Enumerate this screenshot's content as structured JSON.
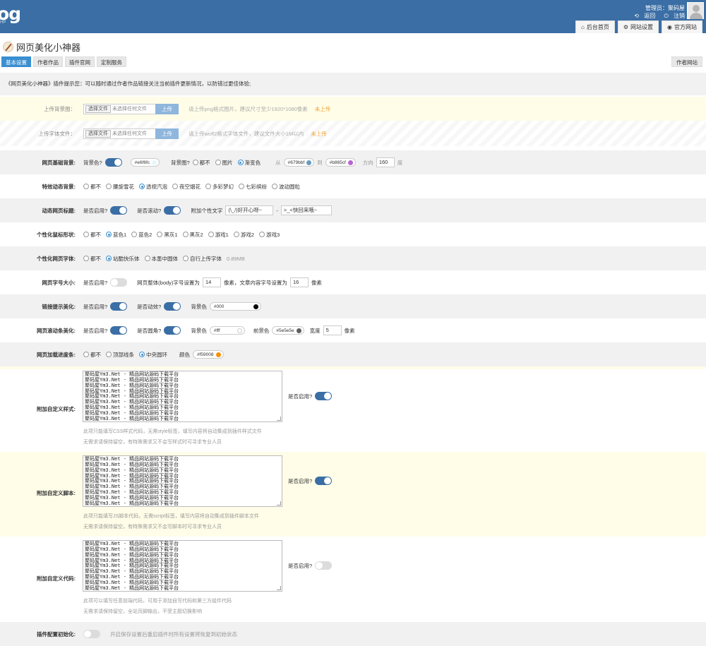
{
  "header": {
    "logo": "og",
    "logo_sub": "HP",
    "admin_label": "管理员：聚码屋",
    "back_link": "返回",
    "logout_link": "注销",
    "nav": [
      {
        "label": "后台首页",
        "icon": "home-icon"
      },
      {
        "label": "网站设置",
        "icon": "gear-icon"
      },
      {
        "label": "官方网站",
        "icon": "compass-icon"
      }
    ]
  },
  "page": {
    "title": "网页美化小神器"
  },
  "tabs": [
    "基本设置",
    "作者作品",
    "插件官网",
    "定制服务"
  ],
  "author_site_btn": "作者网站",
  "notice": "《网页美化小神器》插件提示您：可以随时通过作者作品链接关注当前插件更新情况，以防错过更佳体验;",
  "upload_bg": {
    "label": "上传背景图：",
    "choose": "选择文件",
    "no_file": "未选择任何文件",
    "upload": "上传",
    "hint": "请上传png格式图片，建议尺寸至少1920*1080像素",
    "status": "未上传"
  },
  "upload_font": {
    "label": "上传字体文件：",
    "choose": "选择文件",
    "no_file": "未选择任何文件",
    "upload": "上传",
    "hint": "请上传woff2格式字体文件，建议文件大小1M以内",
    "status": "未上传"
  },
  "bg": {
    "label": "网页基础背景:",
    "color_label": "背景色?",
    "color_value": "#e6f6fc",
    "color_hex": "#e6f6fc",
    "image_label": "背景图?",
    "options": [
      "都不",
      "图片",
      "渐变色"
    ],
    "selected": 2,
    "from_label": "从",
    "from_value": "#679bbf",
    "from_hex": "#679bbf",
    "to_label": "到",
    "to_value": "#b865cf",
    "to_hex": "#b865cf",
    "dir_label": "方向",
    "dir_value": "160",
    "dir_unit": "度"
  },
  "effect": {
    "label": "特效动态背景:",
    "options": [
      "都不",
      "腰旋雪花",
      "透视汽泡",
      "夜空烟花",
      "多彩梦幻",
      "七彩缤纷",
      "波动圆粒"
    ],
    "selected": 2
  },
  "dyntitle": {
    "label": "动态网页标题:",
    "enable_label": "是否启用?",
    "enabled": true,
    "scroll_label": "是否滚动?",
    "scroll": true,
    "text_label": "附加个性文字",
    "text1": "(\\_/)好开心呀~",
    "sep": "-",
    "text2": ">_<快回来哦~"
  },
  "cursor": {
    "label": "个性化鼠标形状:",
    "options": [
      "都不",
      "蓝色1",
      "蓝色2",
      "黑灰1",
      "黑灰2",
      "游戏1",
      "游戏2",
      "游戏3"
    ],
    "selected": 1
  },
  "font": {
    "label": "个性化网页字体:",
    "options": [
      "都不",
      "站酷快乐体",
      "本墨中圆体",
      "自行上传字体"
    ],
    "selected": 1,
    "size_note": "0.89MB"
  },
  "fontsize": {
    "label": "网页字号大小:",
    "enable_label": "是否启用?",
    "enabled": false,
    "body_label": "网页整体(body)字号设置为",
    "body_value": "14",
    "mid": "像素，文章内容字号设置为",
    "content_value": "16",
    "unit": "像素"
  },
  "link": {
    "label": "链接提示美化:",
    "enable_label": "是否启用?",
    "enabled": true,
    "anim_label": "是否动效?",
    "anim": true,
    "bg_label": "背景色",
    "bg_value": "#000",
    "bg_hex": "#000000"
  },
  "scrollbar": {
    "label": "网页滚动条美化:",
    "enable_label": "是否启用?",
    "enabled": true,
    "round_label": "是否圆角?",
    "round": true,
    "bg_label": "背景色",
    "bg_value": "#fff",
    "bg_hex": "#ffffff",
    "fg_label": "前景色",
    "fg_value": "#5e5e5e",
    "fg_hex": "#5e5e5e",
    "width_label": "宽度",
    "width_value": "5",
    "unit": "像素"
  },
  "progress": {
    "label": "网页加载进度条:",
    "options": [
      "都不",
      "顶部线条",
      "中央圆环"
    ],
    "selected": 2,
    "color_label": "颜色",
    "color_value": "#f59008",
    "color_hex": "#f59008"
  },
  "custom_css": {
    "label": "附加自定义样式:",
    "lines": [
      "聚码屋Ym3.Net - 精品网站源码下载平台",
      "聚码屋Ym3.Net - 精品网站源码下载平台",
      "聚码屋Ym3.Net - 精品网站源码下载平台",
      "聚码屋Ym3.Net - 精品网站源码下载平台",
      "聚码屋Ym3.Net - 精品网站源码下载平台",
      "聚码屋Ym3.Net - 精品网站源码下载平台",
      "聚码屋Ym3.Net - 精品网站源码下载平台",
      "聚码屋Ym3.Net - 精品网站源码下载平台",
      "聚码屋Ym3.Net - 精品网站源码下载平台"
    ],
    "enable_label": "是否启用?",
    "enabled": true,
    "help1": "此项只能填写CSS样式代码，无需style标签，填写内容将自动集成到插件样式文件",
    "help2": "无需求请保持留空，有特殊需求又不会写样式时可寻求专业人员"
  },
  "custom_js": {
    "label": "附加自定义脚本:",
    "lines": [
      "聚码屋Ym3.Net - 精品网站源码下载平台",
      "聚码屋Ym3.Net - 精品网站源码下载平台",
      "聚码屋Ym3.Net - 精品网站源码下载平台",
      "聚码屋Ym3.Net - 精品网站源码下载平台",
      "聚码屋Ym3.Net - 精品网站源码下载平台",
      "聚码屋Ym3.Net - 精品网站源码下载平台",
      "聚码屋Ym3.Net - 精品网站源码下载平台",
      "聚码屋Ym3.Net - 精品网站源码下载平台",
      "聚码屋Ym3.Net - 精品网站源码下载平台"
    ],
    "enable_label": "是否启用?",
    "enabled": true,
    "help1": "此项只能填写JS脚本代码，无需script标签，填写内容将自动集成到插件脚本文件",
    "help2": "无需求请保持留空，有特殊需求又不会写脚本时可寻求专业人员"
  },
  "custom_code": {
    "label": "附加自定义代码:",
    "lines": [
      "聚码屋Ym3.Net - 精品网站源码下载平台",
      "聚码屋Ym3.Net - 精品网站源码下载平台",
      "聚码屋Ym3.Net - 精品网站源码下载平台",
      "聚码屋Ym3.Net - 精品网站源码下载平台",
      "聚码屋Ym3.Net - 精品网站源码下载平台",
      "聚码屋Ym3.Net - 精品网站源码下载平台",
      "聚码屋Ym3.Net - 精品网站源码下载平台",
      "聚码屋Ym3.Net - 精品网站源码下载平台",
      "聚码屋Ym3.Net - 精品网站源码下载平台"
    ],
    "enable_label": "是否启用?",
    "enabled": false,
    "help1": "此项可以填写任意前端代码，可用于添加自写代码和第三方组件代码",
    "help2": "无需求请保持留空，全站页脚输出，不受主题切换影响"
  },
  "reset": {
    "label": "插件配置初始化:",
    "enabled": false,
    "text": "开启保存设置后重启插件时所有设置将恢复到初始状态"
  }
}
